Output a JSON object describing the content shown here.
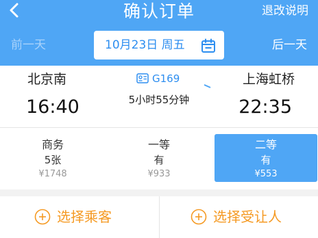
{
  "header": {
    "title": "确认订单",
    "refund_link": "退改说明"
  },
  "date_nav": {
    "prev": "前一天",
    "next": "后一天",
    "current_date": "10月23日 周五"
  },
  "trip": {
    "from_station": "北京南",
    "to_station": "上海虹桥",
    "depart_time": "16:40",
    "arrive_time": "22:35",
    "train_number": "G169",
    "duration": "5小时55分钟"
  },
  "seats": [
    {
      "name": "商务",
      "availability": "5张",
      "price": "¥1748",
      "selected": false
    },
    {
      "name": "一等",
      "availability": "有",
      "price": "¥933",
      "selected": false
    },
    {
      "name": "二等",
      "availability": "有",
      "price": "¥553",
      "selected": true
    }
  ],
  "actions": {
    "select_passenger": "选择乘客",
    "select_assignee": "选择受让人"
  },
  "colors": {
    "primary": "#4fa6f5",
    "accent_orange": "#f59a23"
  }
}
